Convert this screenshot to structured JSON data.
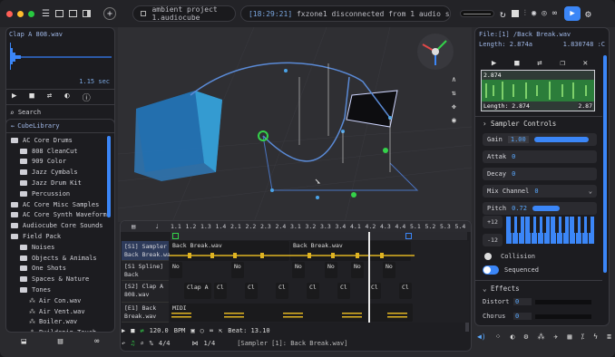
{
  "topbar": {
    "title": "ambient project 1.audiocube",
    "time": "[18:29:21]",
    "log": "fxzone1 disconnected from 1 audio sources on:"
  },
  "sample_preview": {
    "name": "Clap A 808.wav",
    "length": "1.15 sec"
  },
  "search": {
    "placeholder": "Search"
  },
  "library": {
    "header": "CubeLibrary",
    "items": [
      {
        "label": "AC Core Drums",
        "type": "folder",
        "indent": 0
      },
      {
        "label": "808 CleanCut",
        "type": "folder",
        "indent": 1
      },
      {
        "label": "909 Color",
        "type": "folder",
        "indent": 1
      },
      {
        "label": "Jazz Cymbals",
        "type": "folder",
        "indent": 1
      },
      {
        "label": "Jazz Drum Kit",
        "type": "folder",
        "indent": 1
      },
      {
        "label": "Percussion",
        "type": "folder",
        "indent": 1
      },
      {
        "label": "AC Core Misc Samples",
        "type": "folder",
        "indent": 0
      },
      {
        "label": "AC Core Synth Waveform",
        "type": "folder",
        "indent": 0
      },
      {
        "label": "Audiocube Core Sounds",
        "type": "folder",
        "indent": 0
      },
      {
        "label": "Field Pack",
        "type": "folder",
        "indent": 0
      },
      {
        "label": "Noises",
        "type": "folder",
        "indent": 1
      },
      {
        "label": "Objects & Animals",
        "type": "folder",
        "indent": 1
      },
      {
        "label": "One Shots",
        "type": "folder",
        "indent": 1
      },
      {
        "label": "Spaces & Nature",
        "type": "folder",
        "indent": 1
      },
      {
        "label": "Tones",
        "type": "folder",
        "indent": 1
      },
      {
        "label": "Air Con.wav",
        "type": "file",
        "indent": 2
      },
      {
        "label": "Air Vent.wav",
        "type": "file",
        "indent": 2
      },
      {
        "label": "Boiler.wav",
        "type": "file",
        "indent": 2
      },
      {
        "label": "Buildenin Touch",
        "type": "file",
        "indent": 2
      }
    ]
  },
  "timeline": {
    "ruler": [
      "1.1",
      "1.2",
      "1.3",
      "1.4",
      "2.1",
      "2.2",
      "2.3",
      "2.4",
      "3.1",
      "3.2",
      "3.3",
      "3.4",
      "4.1",
      "4.2",
      "4.3",
      "4.4",
      "5.1",
      "5.2",
      "5.3",
      "5.4"
    ],
    "tracks": [
      {
        "label": "[S1] Sampler\nBack Break.wav"
      },
      {
        "label": "[S1 Spline]\nBack"
      },
      {
        "label": "[S2] Clap A\n808.wav"
      },
      {
        "label": "[E1] Back\nBreak.wav"
      }
    ],
    "clips": {
      "t1a": "Back Break.wav",
      "t1b": "Back Break.wav",
      "no": "No",
      "clapa": "Clap A",
      "c1": "Cl",
      "midi": "MIDI"
    },
    "transport": {
      "bpm": "120.0",
      "bpm_unit": "BPM",
      "beat": "Beat: 13.10",
      "signature": "4/4",
      "quant": "1/4",
      "status": "[Sampler [1]: Back Break.wav]"
    }
  },
  "inspector": {
    "file": "File:[1] /Back Break.wav",
    "length": "Length: 2.874a",
    "length_right": "1.830748 :C",
    "wave_top": "2.874",
    "wave_bottom": "Length: 2.874",
    "wave_bottom_right": "2.87",
    "section": "Sampler Controls",
    "gain_label": "Gain",
    "gain_value": "1.00",
    "attack_label": "Attak",
    "attack_value": "0",
    "decay_label": "Decay",
    "decay_value": "0",
    "mix_label": "Mix Channel",
    "mix_value": "0",
    "pitch_label": "Pitch",
    "pitch_value": "0.72",
    "oct_up": "+12",
    "oct_down": "-12",
    "collision": "Collision",
    "sequenced": "Sequenced",
    "effects": "Effects",
    "distort_label": "Distort",
    "distort_value": "0",
    "chorus_label": "Chorus",
    "chorus_value": "0"
  },
  "colors": {
    "accent": "#3b86f7",
    "clip_yellow": "#e0b422",
    "wave_green": "#2f8a3a"
  }
}
